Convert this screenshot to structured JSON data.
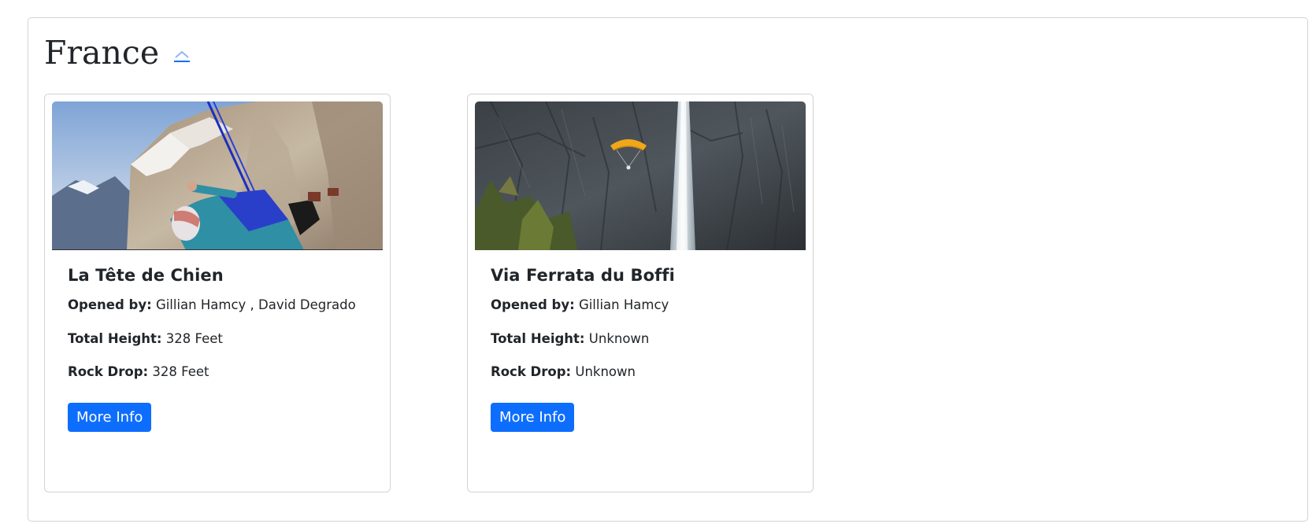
{
  "section": {
    "title": "France",
    "toggle_icon": "chevron-up-icon"
  },
  "colors": {
    "accent": "#0d6efd",
    "text": "#212529",
    "border": "#d3d3d3"
  },
  "cards": [
    {
      "name": "La Tête de Chien",
      "image": "base-jumper-cliff-photo",
      "opened_by_label": "Opened by:",
      "opened_by": "Gillian Hamcy , David Degrado",
      "total_height_label": "Total Height:",
      "total_height": "328 Feet",
      "rock_drop_label": "Rock Drop:",
      "rock_drop": "328 Feet",
      "button": "More Info"
    },
    {
      "name": "Via Ferrata du Boffi",
      "image": "paraglider-waterfall-photo",
      "opened_by_label": "Opened by:",
      "opened_by": "Gillian Hamcy",
      "total_height_label": "Total Height:",
      "total_height": "Unknown",
      "rock_drop_label": "Rock Drop:",
      "rock_drop": "Unknown",
      "button": "More Info"
    }
  ]
}
